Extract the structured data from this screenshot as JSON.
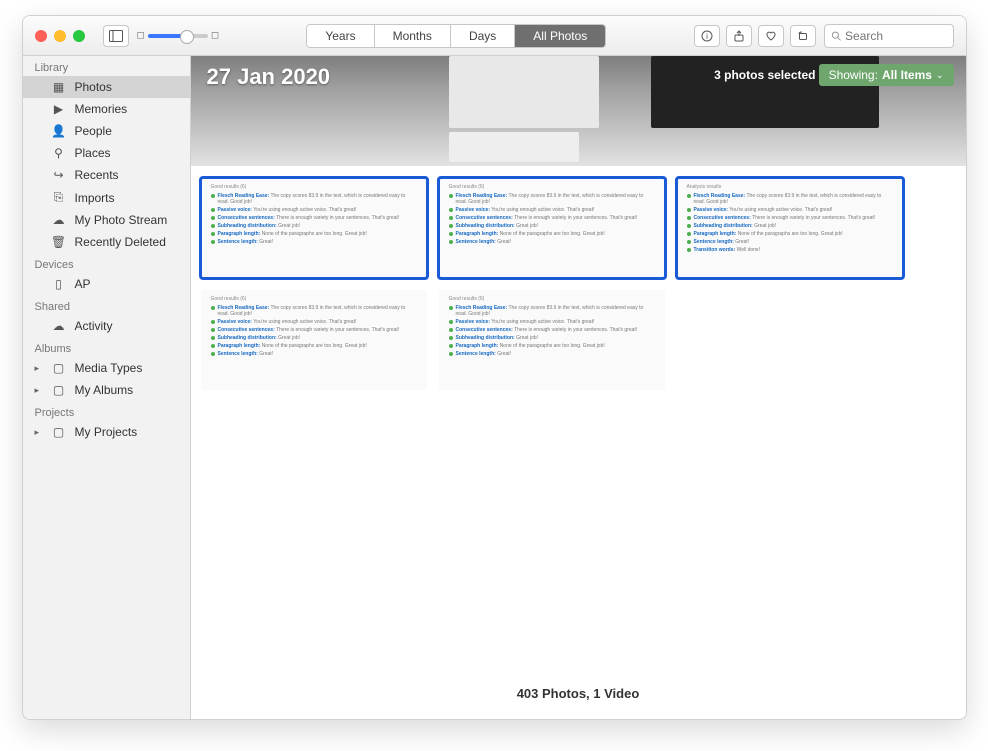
{
  "header": {
    "views": [
      "Years",
      "Months",
      "Days",
      "All Photos"
    ],
    "active_view": "All Photos",
    "search_placeholder": "Search"
  },
  "sidebar": {
    "sections": [
      {
        "title": "Library",
        "items": [
          {
            "label": "Photos",
            "icon": "photos-icon",
            "selected": true
          },
          {
            "label": "Memories",
            "icon": "memories-icon"
          },
          {
            "label": "People",
            "icon": "people-icon"
          },
          {
            "label": "Places",
            "icon": "places-icon"
          },
          {
            "label": "Recents",
            "icon": "recents-icon"
          },
          {
            "label": "Imports",
            "icon": "imports-icon"
          },
          {
            "label": "My Photo Stream",
            "icon": "cloud-icon"
          },
          {
            "label": "Recently Deleted",
            "icon": "trash-icon"
          }
        ]
      },
      {
        "title": "Devices",
        "items": [
          {
            "label": "AP",
            "icon": "device-icon"
          }
        ]
      },
      {
        "title": "Shared",
        "items": [
          {
            "label": "Activity",
            "icon": "cloud-icon"
          }
        ]
      },
      {
        "title": "Albums",
        "items": [
          {
            "label": "Media Types",
            "icon": "folder-icon",
            "disclosure": true
          },
          {
            "label": "My Albums",
            "icon": "folder-icon",
            "disclosure": true
          }
        ]
      },
      {
        "title": "Projects",
        "items": [
          {
            "label": "My Projects",
            "icon": "folder-icon",
            "disclosure": true
          }
        ]
      }
    ]
  },
  "hero": {
    "date": "27 Jan 2020",
    "selection_count": "3 photos selected",
    "showing_label": "Showing:",
    "showing_value": "All Items"
  },
  "thumb_content": {
    "header": "Good results (6)",
    "lines": [
      {
        "dot": "#4caf50",
        "k": "Flesch Reading Ease:",
        "v": "The copy scores 83.9 in the test, which is considered easy to read. Good job!"
      },
      {
        "dot": "#4caf50",
        "k": "Passive voice:",
        "v": "You're using enough active voice. That's great!"
      },
      {
        "dot": "#4caf50",
        "k": "Consecutive sentences:",
        "v": "There is enough variety in your sentences. That's great!"
      },
      {
        "dot": "#4caf50",
        "k": "Subheading distribution:",
        "v": "Great job!"
      },
      {
        "dot": "#4caf50",
        "k": "Paragraph length:",
        "v": "None of the paragraphs are too long. Great job!"
      },
      {
        "dot": "#4caf50",
        "k": "Sentence length:",
        "v": "Great!"
      }
    ],
    "header2": "Analysis results",
    "extra_line": {
      "dot": "#4caf50",
      "k": "Transition words:",
      "v": "Well done!"
    }
  },
  "thumbs": [
    {
      "selected": true
    },
    {
      "selected": true
    },
    {
      "selected": true,
      "variant": "analysis"
    },
    {
      "selected": false
    },
    {
      "selected": false
    }
  ],
  "footer": "403 Photos, 1 Video"
}
